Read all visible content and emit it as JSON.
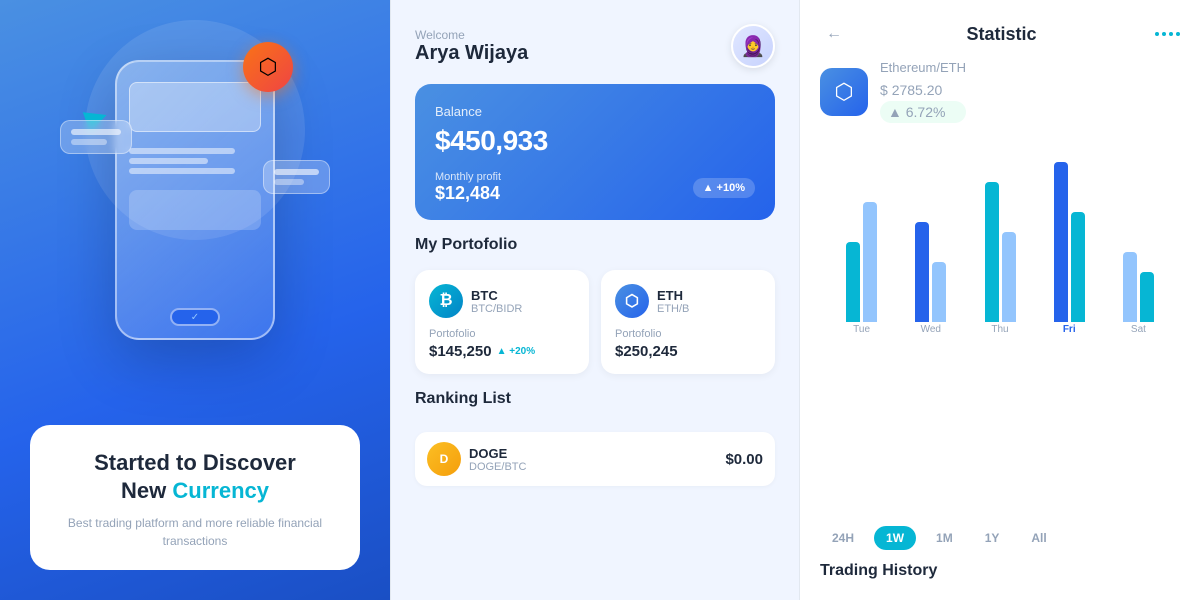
{
  "panel1": {
    "title_part1": "Started  to Discover",
    "title_part2": "New",
    "title_highlight": "Currency",
    "subtitle": "Best trading platform and more reliable financial transactions",
    "eth_symbol": "⬡",
    "arrow_symbol": "▶"
  },
  "panel2": {
    "welcome": "Welcome",
    "user_name": "Arya Wijaya",
    "balance_label": "Balance",
    "balance_amount": "$450,933",
    "profit_label": "Monthly profit",
    "profit_amount": "$12,484",
    "profit_badge": "+10%",
    "portfolio_title": "My Portofolio",
    "portfolio": [
      {
        "coin": "BTC",
        "pair": "BTC/BIDR",
        "label": "Portofolio",
        "amount": "$145,250",
        "change": "+20%"
      },
      {
        "coin": "ETH",
        "pair": "ETH/B",
        "label": "Portofolio",
        "amount": "$250,245",
        "change": null
      }
    ],
    "ranking_title": "Ranking List",
    "ranking": [
      {
        "coin": "DOGE",
        "pair": "DOGE/BTC",
        "amount": "$0.00"
      }
    ]
  },
  "panel3": {
    "title": "Statistic",
    "coin_name": "Ethereum/ETH",
    "coin_price": "2785.20",
    "price_change": "▲ 6.72%",
    "chart": {
      "bars": [
        {
          "label": "Tue",
          "active": false,
          "heights": [
            80,
            120
          ]
        },
        {
          "label": "Wed",
          "active": false,
          "heights": [
            100,
            60
          ]
        },
        {
          "label": "Thu",
          "active": false,
          "heights": [
            140,
            90
          ]
        },
        {
          "label": "Fri",
          "active": true,
          "heights": [
            160,
            110
          ]
        },
        {
          "label": "Sat",
          "active": false,
          "heights": [
            70,
            50
          ]
        }
      ]
    },
    "time_filters": [
      "24H",
      "1W",
      "1M",
      "1Y",
      "All"
    ],
    "active_filter": "1W",
    "trading_history": "Trading History"
  }
}
